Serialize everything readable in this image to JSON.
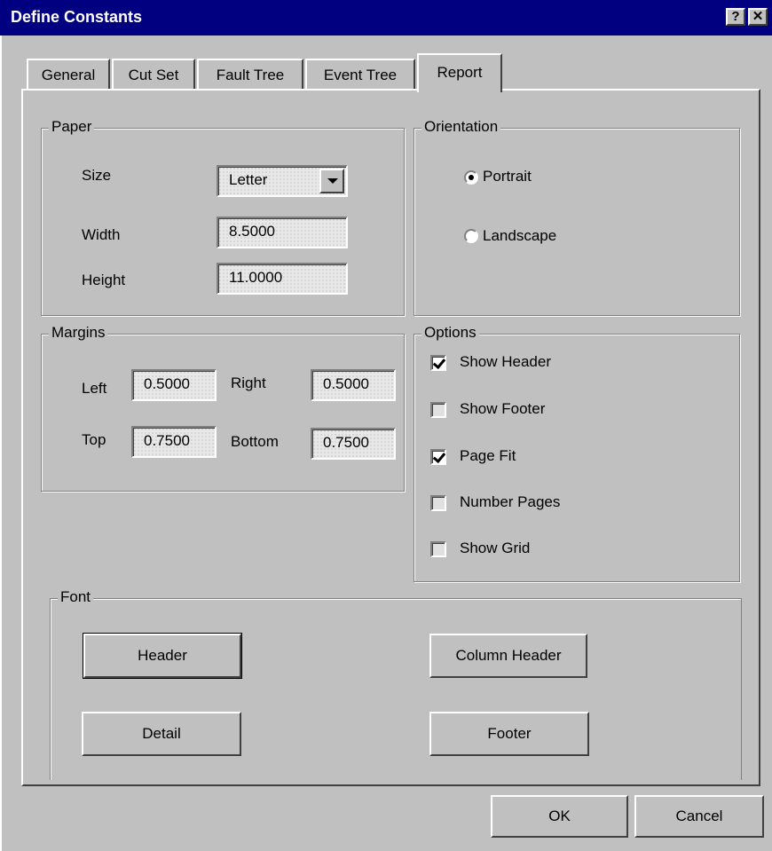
{
  "window": {
    "title": "Define Constants",
    "help_button": "?",
    "close_button": "✕"
  },
  "tabs": [
    {
      "label": "General",
      "active": false
    },
    {
      "label": "Cut Set",
      "active": false
    },
    {
      "label": "Fault Tree",
      "active": false
    },
    {
      "label": "Event Tree",
      "active": false
    },
    {
      "label": "Report",
      "active": true
    }
  ],
  "paper": {
    "group_label": "Paper",
    "size_label": "Size",
    "size_value": "Letter",
    "width_label": "Width",
    "width_value": "8.5000",
    "height_label": "Height",
    "height_value": "11.0000"
  },
  "orientation": {
    "group_label": "Orientation",
    "options": [
      {
        "label": "Portrait",
        "selected": true
      },
      {
        "label": "Landscape",
        "selected": false
      }
    ]
  },
  "margins": {
    "group_label": "Margins",
    "left_label": "Left",
    "left_value": "0.5000",
    "right_label": "Right",
    "right_value": "0.5000",
    "top_label": "Top",
    "top_value": "0.7500",
    "bottom_label": "Bottom",
    "bottom_value": "0.7500"
  },
  "options": {
    "group_label": "Options",
    "items": [
      {
        "label": "Show Header",
        "checked": true
      },
      {
        "label": "Show Footer",
        "checked": false
      },
      {
        "label": "Page Fit",
        "checked": true
      },
      {
        "label": "Number Pages",
        "checked": false
      },
      {
        "label": "Show Grid",
        "checked": false
      }
    ]
  },
  "font": {
    "group_label": "Font",
    "header_button": "Header",
    "column_header_button": "Column Header",
    "detail_button": "Detail",
    "footer_button": "Footer"
  },
  "dialog_buttons": {
    "ok": "OK",
    "cancel": "Cancel"
  }
}
